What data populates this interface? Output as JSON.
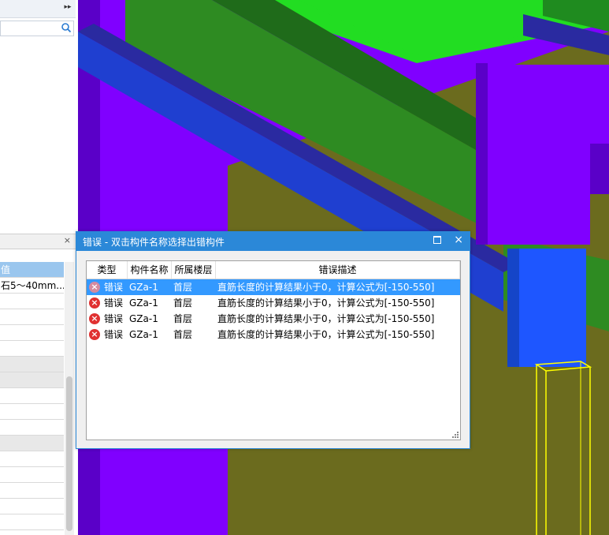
{
  "left_panel": {
    "collapse_glyph": "▸▸",
    "search_placeholder": "",
    "props_close_glyph": "×",
    "props_rows": [
      {
        "text": "值",
        "kind": "head"
      },
      {
        "text": "石5～40mm...",
        "kind": "row"
      },
      {
        "text": "",
        "kind": "row"
      },
      {
        "text": "",
        "kind": "row"
      },
      {
        "text": "",
        "kind": "row"
      },
      {
        "text": "",
        "kind": "row"
      },
      {
        "text": "",
        "kind": "group"
      },
      {
        "text": "",
        "kind": "group"
      },
      {
        "text": "",
        "kind": "row"
      },
      {
        "text": "",
        "kind": "row"
      },
      {
        "text": "",
        "kind": "row"
      },
      {
        "text": "",
        "kind": "group"
      },
      {
        "text": "",
        "kind": "row"
      },
      {
        "text": "",
        "kind": "row"
      },
      {
        "text": "",
        "kind": "row"
      },
      {
        "text": "",
        "kind": "row"
      },
      {
        "text": "",
        "kind": "row"
      }
    ]
  },
  "dialog": {
    "title": "错误 - 双击构件名称选择出错构件",
    "close_glyph": "×",
    "columns": {
      "type": "类型",
      "name": "构件名称",
      "floor": "所属楼层",
      "desc": "错误描述"
    },
    "rows": [
      {
        "type": "错误",
        "name": "GZa-1",
        "floor": "首层",
        "desc": "直筋长度的计算结果小于0，计算公式为[-150-550]",
        "selected": true
      },
      {
        "type": "错误",
        "name": "GZa-1",
        "floor": "首层",
        "desc": "直筋长度的计算结果小于0，计算公式为[-150-550]",
        "selected": false
      },
      {
        "type": "错误",
        "name": "GZa-1",
        "floor": "首层",
        "desc": "直筋长度的计算结果小于0，计算公式为[-150-550]",
        "selected": false
      },
      {
        "type": "错误",
        "name": "GZa-1",
        "floor": "首层",
        "desc": "直筋长度的计算结果小于0，计算公式为[-150-550]",
        "selected": false
      }
    ]
  },
  "colors": {
    "accent": "#2b88d8",
    "selection": "#3399ff",
    "error": "#e03131",
    "model_purple": "#8000ff",
    "model_green": "#2e8b22",
    "model_bright_green": "#22dd22",
    "model_olive": "#6b6b1e",
    "model_blue": "#1f3fd0",
    "model_highlight": "#ffff00"
  }
}
